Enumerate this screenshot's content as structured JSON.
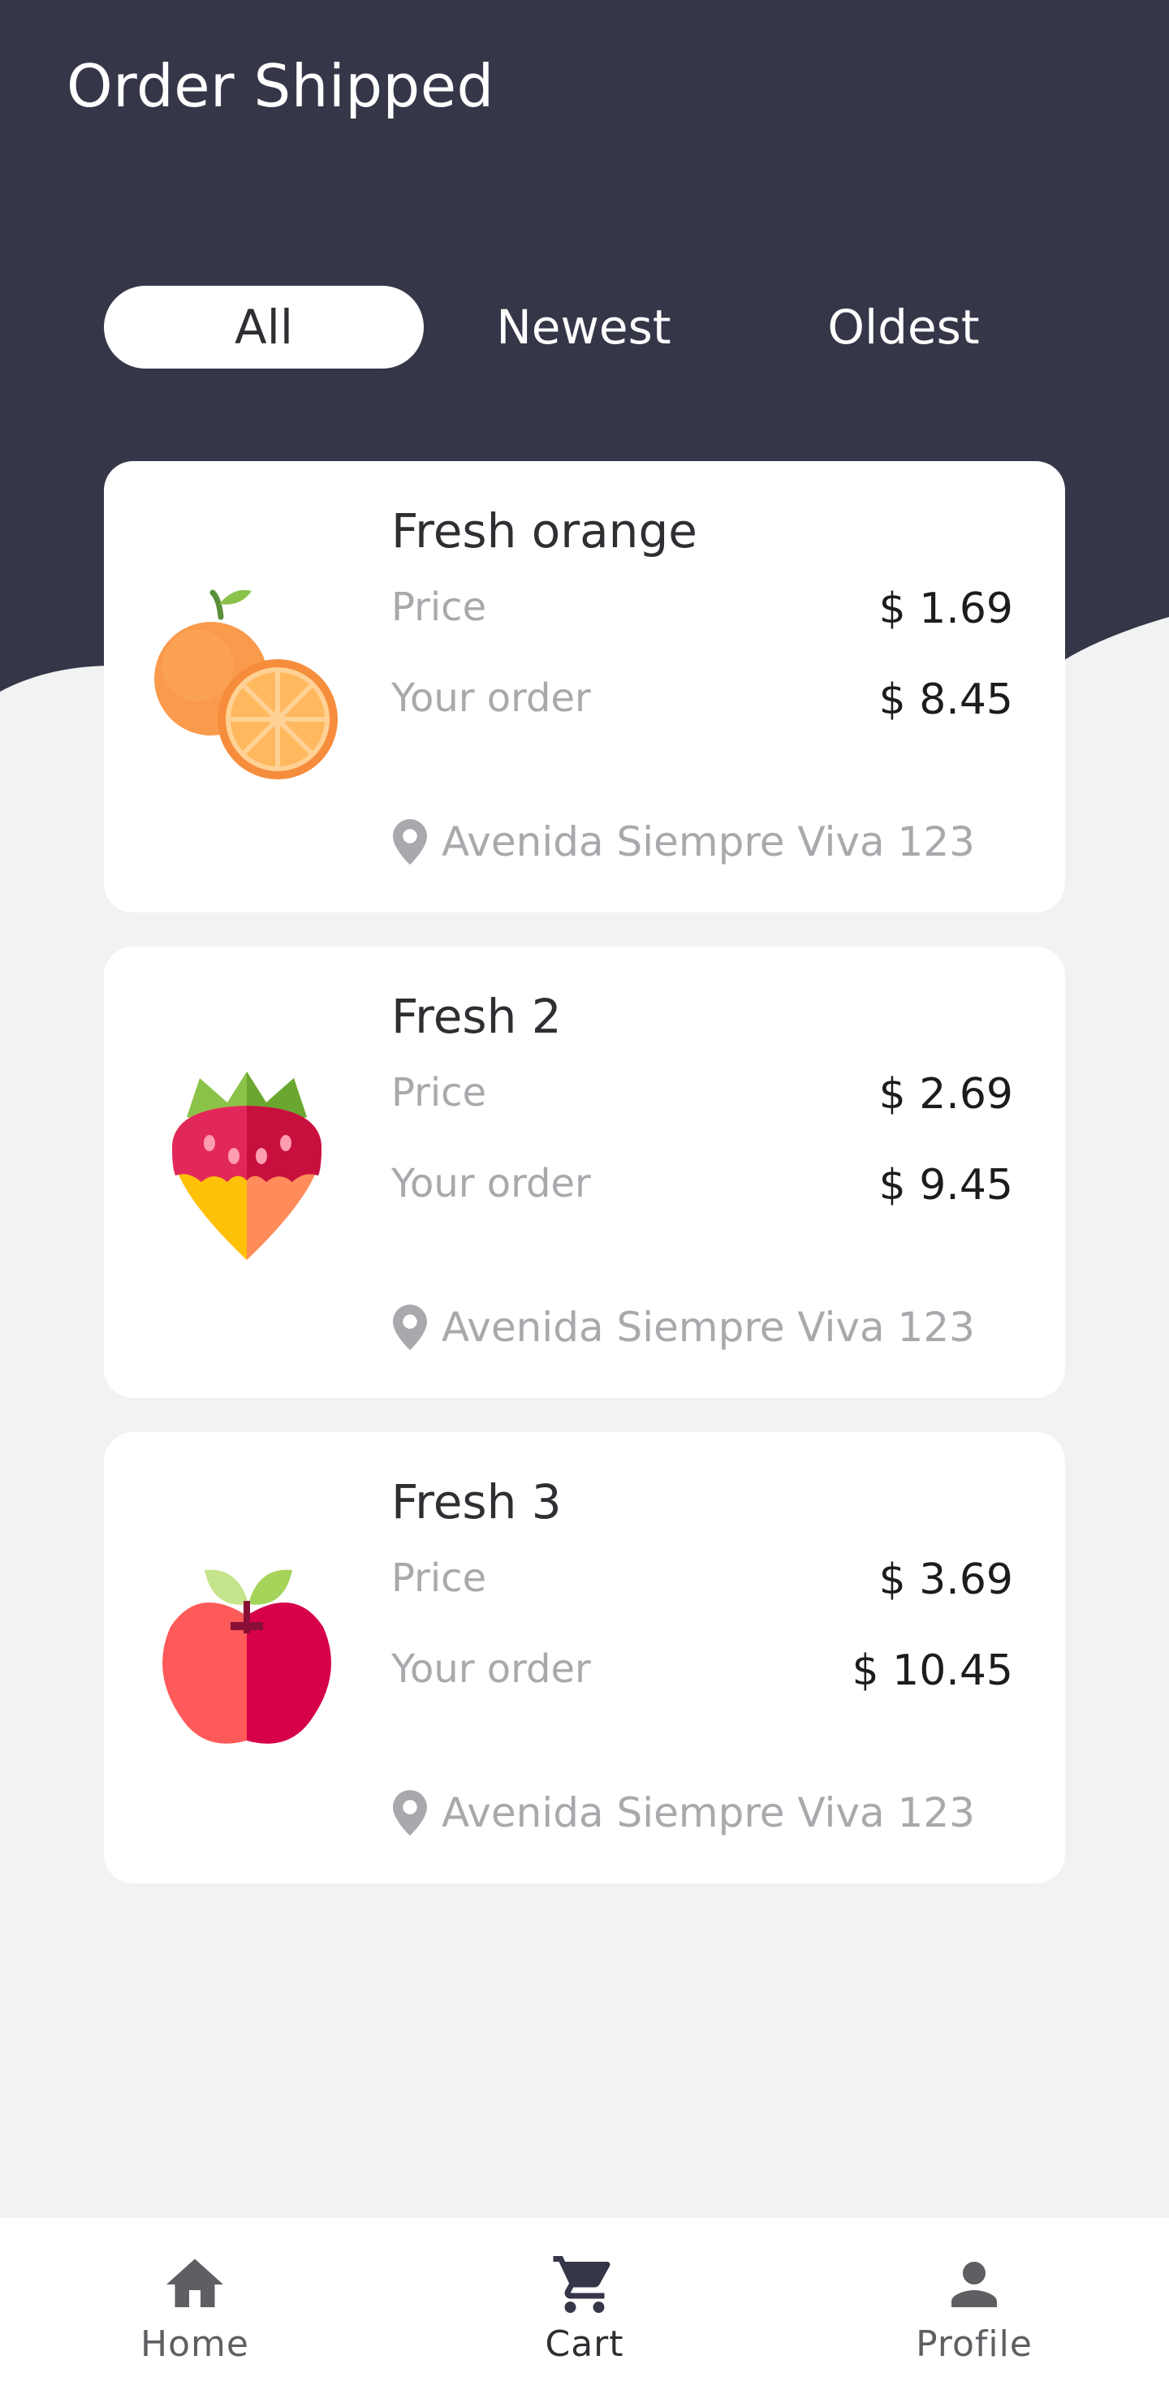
{
  "header": {
    "title": "Order Shipped"
  },
  "filters": [
    {
      "label": "All",
      "active": true
    },
    {
      "label": "Newest",
      "active": false
    },
    {
      "label": "Oldest",
      "active": false
    }
  ],
  "orders": [
    {
      "name": "Fresh orange",
      "price_label": "Price",
      "price": "$ 1.69",
      "order_label": "Your order",
      "order_total": "$ 8.45",
      "address": "Avenida Siempre Viva 123",
      "icon": "orange-icon"
    },
    {
      "name": "Fresh 2",
      "price_label": "Price",
      "price": "$ 2.69",
      "order_label": "Your order",
      "order_total": "$ 9.45",
      "address": "Avenida Siempre Viva 123",
      "icon": "strawberry-icon"
    },
    {
      "name": "Fresh 3",
      "price_label": "Price",
      "price": "$ 3.69",
      "order_label": "Your order",
      "order_total": "$ 10.45",
      "address": "Avenida Siempre Viva 123",
      "icon": "apple-icon"
    }
  ],
  "bottom_nav": [
    {
      "label": "Home",
      "icon": "home-icon",
      "active": false
    },
    {
      "label": "Cart",
      "icon": "cart-icon",
      "active": true
    },
    {
      "label": "Profile",
      "icon": "profile-icon",
      "active": false
    }
  ],
  "colors": {
    "header_bg": "#363649",
    "page_bg": "#f1f2f2",
    "card_bg": "#ffffff",
    "muted_text": "#a9a9ad"
  }
}
